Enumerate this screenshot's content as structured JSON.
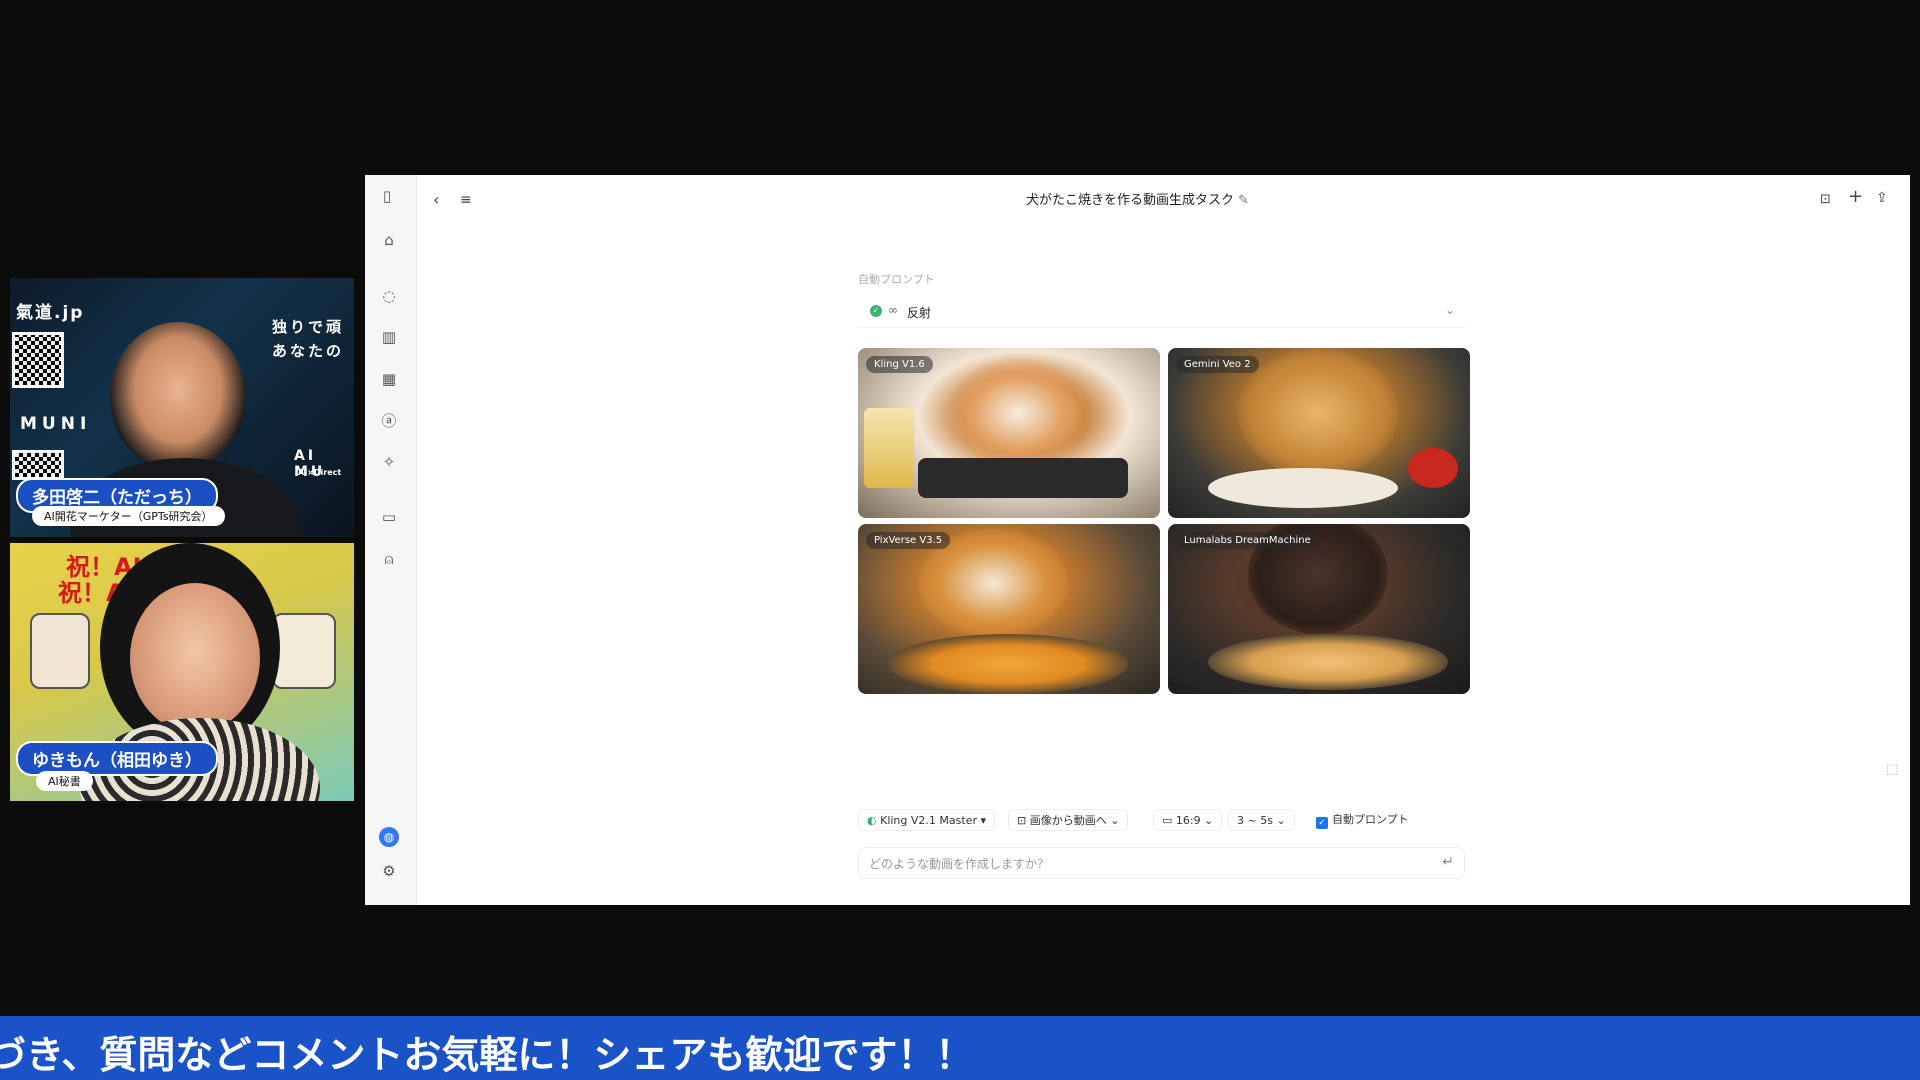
{
  "participants": [
    {
      "name": "多田啓二（ただっち）",
      "role": "AI開花マーケター（GPTs研究会）",
      "bg_texts": [
        "氣道.jp",
        "独りで頑",
        "あなたの",
        "MUNI",
        "AI MU",
        "AI×Direct"
      ]
    },
    {
      "name": "ゆきもん（相田ゆき）",
      "role": "AI秘書",
      "bg_texts": [
        "祝！AIM",
        "祝！AI"
      ]
    }
  ],
  "window": {
    "title": "犬がたこ焼きを作る動画生成タスク",
    "auto_prompt_label": "自動プロンプト",
    "reflect_label": "反射",
    "videos": [
      {
        "model": "Kling V1.6"
      },
      {
        "model": "Gemini Veo 2"
      },
      {
        "model": "PixVerse V3.5"
      },
      {
        "model": "Lumalabs DreamMachine"
      }
    ],
    "toolbar": {
      "model": "Kling V2.1 Master",
      "mode": "画像から動画へ",
      "ratio": "16:9",
      "duration": "3 ~ 5s",
      "auto_prompt": "自動プロンプト"
    },
    "prompt_placeholder": "どのような動画を作成しますか？"
  },
  "ticker": "づき、質問などコメントお気軽に！シェアも歓迎です！！",
  "colors": {
    "accent": "#1a52c8",
    "badge": "#1d4fc4",
    "check": "#3cb371"
  }
}
